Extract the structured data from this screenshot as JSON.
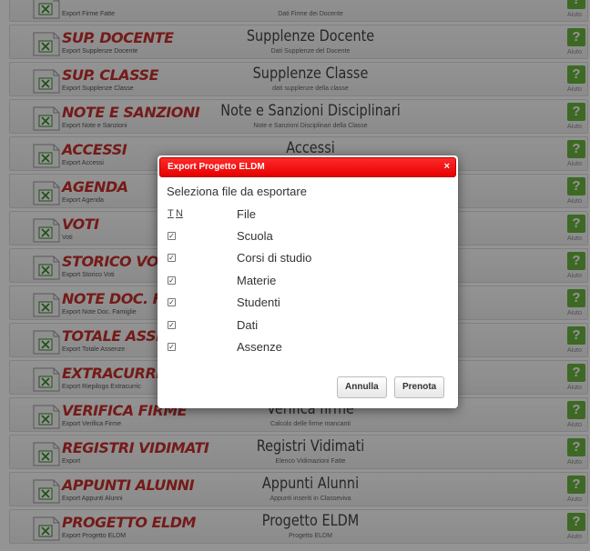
{
  "help_label": "Aiuto",
  "help_glyph": "?",
  "rows": [
    {
      "title": "",
      "sub": "Export Firme Fatte",
      "center_title": "",
      "center_sub": "Dati Firme dei Docente"
    },
    {
      "title": "Sup. Docente",
      "sub": "Export Supplenze Docente",
      "center_title": "Supplenze Docente",
      "center_sub": "Dati Supplenze del Docente"
    },
    {
      "title": "Sup. Classe",
      "sub": "Export Supplenze Classe",
      "center_title": "Supplenze Classe",
      "center_sub": "dati supplenze della classe"
    },
    {
      "title": "Note e Sanzioni",
      "sub": "Export Note e Sanzioni",
      "center_title": "Note e Sanzioni Disciplinari",
      "center_sub": "Note e Sanzioni Disciplinari della Classe"
    },
    {
      "title": "Accessi",
      "sub": "Export Accessi",
      "center_title": "Accessi",
      "center_sub": ""
    },
    {
      "title": "Agenda",
      "sub": "Export Agenda",
      "center_title": "",
      "center_sub": ""
    },
    {
      "title": "Voti",
      "sub": "Voti",
      "center_title": "",
      "center_sub": ""
    },
    {
      "title": "Storico Voti",
      "sub": "Export Storico Voti",
      "center_title": "",
      "center_sub": ""
    },
    {
      "title": "Note Doc. Fam.",
      "sub": "Export Note Doc. Famiglie",
      "center_title": "",
      "center_sub": ""
    },
    {
      "title": "Totale Assenze",
      "sub": "Export Totale Assenze",
      "center_title": "",
      "center_sub": ""
    },
    {
      "title": "Extracurricula",
      "sub": "Export Riepilogo Extracurric",
      "center_title": "",
      "center_sub": ""
    },
    {
      "title": "Verifica Firme",
      "sub": "Export Verifica Firme",
      "center_title": "Verifica firme",
      "center_sub": "Calcolo delle firme mancanti"
    },
    {
      "title": "Registri Vidimati",
      "sub": "Export",
      "center_title": "Registri Vidimati",
      "center_sub": "Elenco Vidimazioni Fatte"
    },
    {
      "title": "Appunti Alunni",
      "sub": "Export Appunti Alunni",
      "center_title": "Appunti Alunni",
      "center_sub": "Appunti inseriti in Classeviva"
    },
    {
      "title": "Progetto ELDM",
      "sub": "Export Progetto ELDM",
      "center_title": "Progetto ELDM",
      "center_sub": "Progetto ELDM"
    }
  ],
  "dialog": {
    "title": "Export Progetto ELDM",
    "close": "×",
    "label": "Seleziona file da esportare",
    "col_t": "T",
    "col_n": "N",
    "col_file": "File",
    "check_glyph": "✓",
    "files": [
      "Scuola",
      "Corsi di studio",
      "Materie",
      "Studenti",
      "Dati",
      "Assenze"
    ],
    "cancel": "Annulla",
    "submit": "Prenota"
  },
  "colors": {
    "accent_red": "#e50000",
    "title_red": "#c9302c",
    "help_green": "#6ab53e"
  }
}
